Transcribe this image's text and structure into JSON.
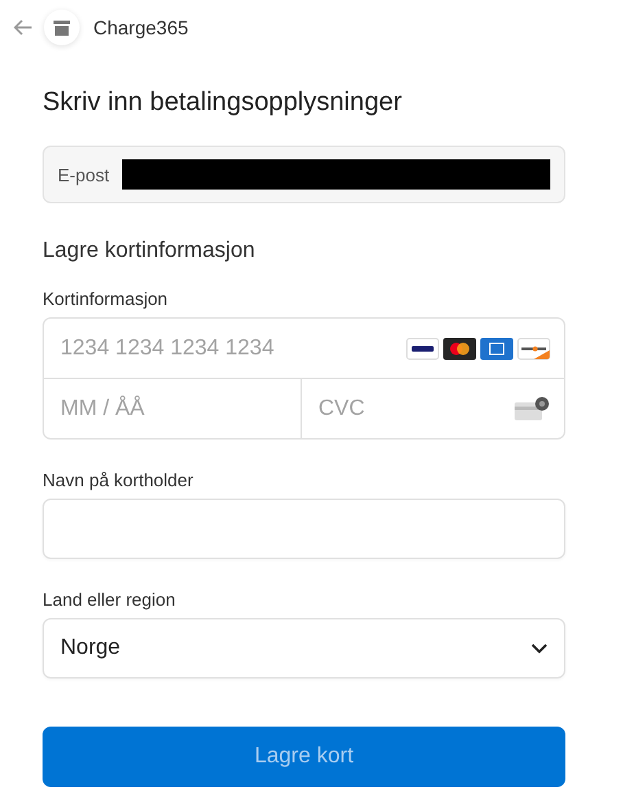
{
  "header": {
    "merchant": "Charge365"
  },
  "title": "Skriv inn betalingsopplysninger",
  "email": {
    "label": "E-post",
    "redacted": true
  },
  "section_title": "Lagre kortinformasjon",
  "card": {
    "label": "Kortinformasjon",
    "number_placeholder": "1234 1234 1234 1234",
    "expiry_placeholder": "MM / ÅÅ",
    "cvc_placeholder": "CVC"
  },
  "name": {
    "label": "Navn på kortholder"
  },
  "country": {
    "label": "Land eller region",
    "value": "Norge"
  },
  "button": {
    "label": "Lagre kort",
    "disabled": true
  }
}
